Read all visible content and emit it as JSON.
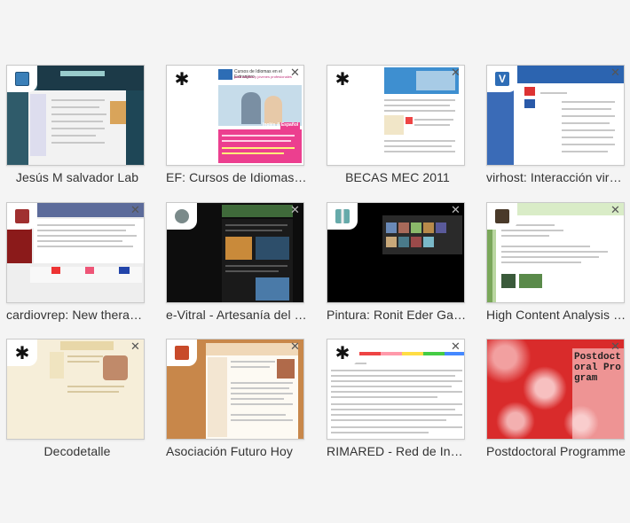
{
  "tiles": [
    {
      "title": "Jesús M salvador Lab",
      "icon": "globe-favicon-icon",
      "centered": true
    },
    {
      "title": "EF: Cursos de Idiomas en el Extranjero",
      "icon": "asterisk-favicon-icon",
      "centered": false
    },
    {
      "title": "BECAS MEC 2011",
      "icon": "asterisk-favicon-icon",
      "centered": true
    },
    {
      "title": "virhost: Interacción virus-hospedador",
      "icon": "v-favicon-icon",
      "centered": false
    },
    {
      "title": "cardiovrep: New therapeutic approaches",
      "icon": "site-favicon-icon",
      "centered": false
    },
    {
      "title": "e-Vitral - Artesanía del vidrio",
      "icon": "globe-favicon-icon",
      "centered": false
    },
    {
      "title": "Pintura: Ronit Eder Gallery",
      "icon": "book-favicon-icon",
      "centered": false
    },
    {
      "title": "High Content Analysis Unit",
      "icon": "site-favicon-icon",
      "centered": false
    },
    {
      "title": "Decodetalle",
      "icon": "asterisk-favicon-icon",
      "centered": true
    },
    {
      "title": "Asociación Futuro Hoy",
      "icon": "site-favicon-icon",
      "centered": false
    },
    {
      "title": "RIMARED - Red de Investigación",
      "icon": "asterisk-favicon-icon",
      "centered": false
    },
    {
      "title": "Postdoctoral Programme",
      "icon": "none",
      "centered": false
    }
  ],
  "thumb_text": {
    "ef_heading": "Cursos de Idiomas en el Extranjero",
    "ef_sub": "para adultos y jóvenes profesionales",
    "ef_cta": "Inglés & Español",
    "postdoc": "Postdoctoral Program",
    "close_glyph": "✕",
    "asterisk_glyph": "✱",
    "v_glyph": "V"
  }
}
